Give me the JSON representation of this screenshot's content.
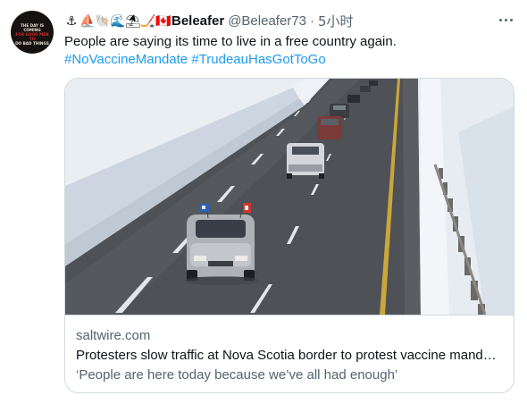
{
  "author": {
    "avatar_text_lines": [
      "THE DAY IS COMING",
      "FOR GOOD MEN TO",
      "DO BAD THINGS"
    ],
    "emojis": [
      {
        "icon": "anchor-icon",
        "glyph": "⚓"
      },
      {
        "icon": "sailboat-icon",
        "glyph": "⛵"
      },
      {
        "icon": "shell-icon",
        "glyph": "🐚"
      },
      {
        "icon": "wave-icon",
        "glyph": "🌊"
      },
      {
        "icon": "beach-umbrella-icon",
        "glyph": "⛱"
      },
      {
        "icon": "hockey-icon",
        "glyph": "🏒"
      },
      {
        "icon": "canada-flag-icon",
        "glyph": "🇨🇦"
      }
    ],
    "display_name": "Beleafer",
    "handle": "@Beleafer73",
    "separator": "·",
    "time": "5小时"
  },
  "tweet": {
    "text": "People are saying its time to live in a free country again.",
    "hashtags": [
      "#NoVaccineMandate",
      "#TrudeauHasGotToGo"
    ]
  },
  "card": {
    "domain": "saltwire.com",
    "title": "Protesters slow traffic at Nova Scotia border to protest vaccine mand…",
    "description": "‘People are here today because we’ve all had enough’"
  },
  "colors": {
    "link": "#1d9bf0",
    "secondary_text": "#536471",
    "border": "#cfd9de"
  }
}
